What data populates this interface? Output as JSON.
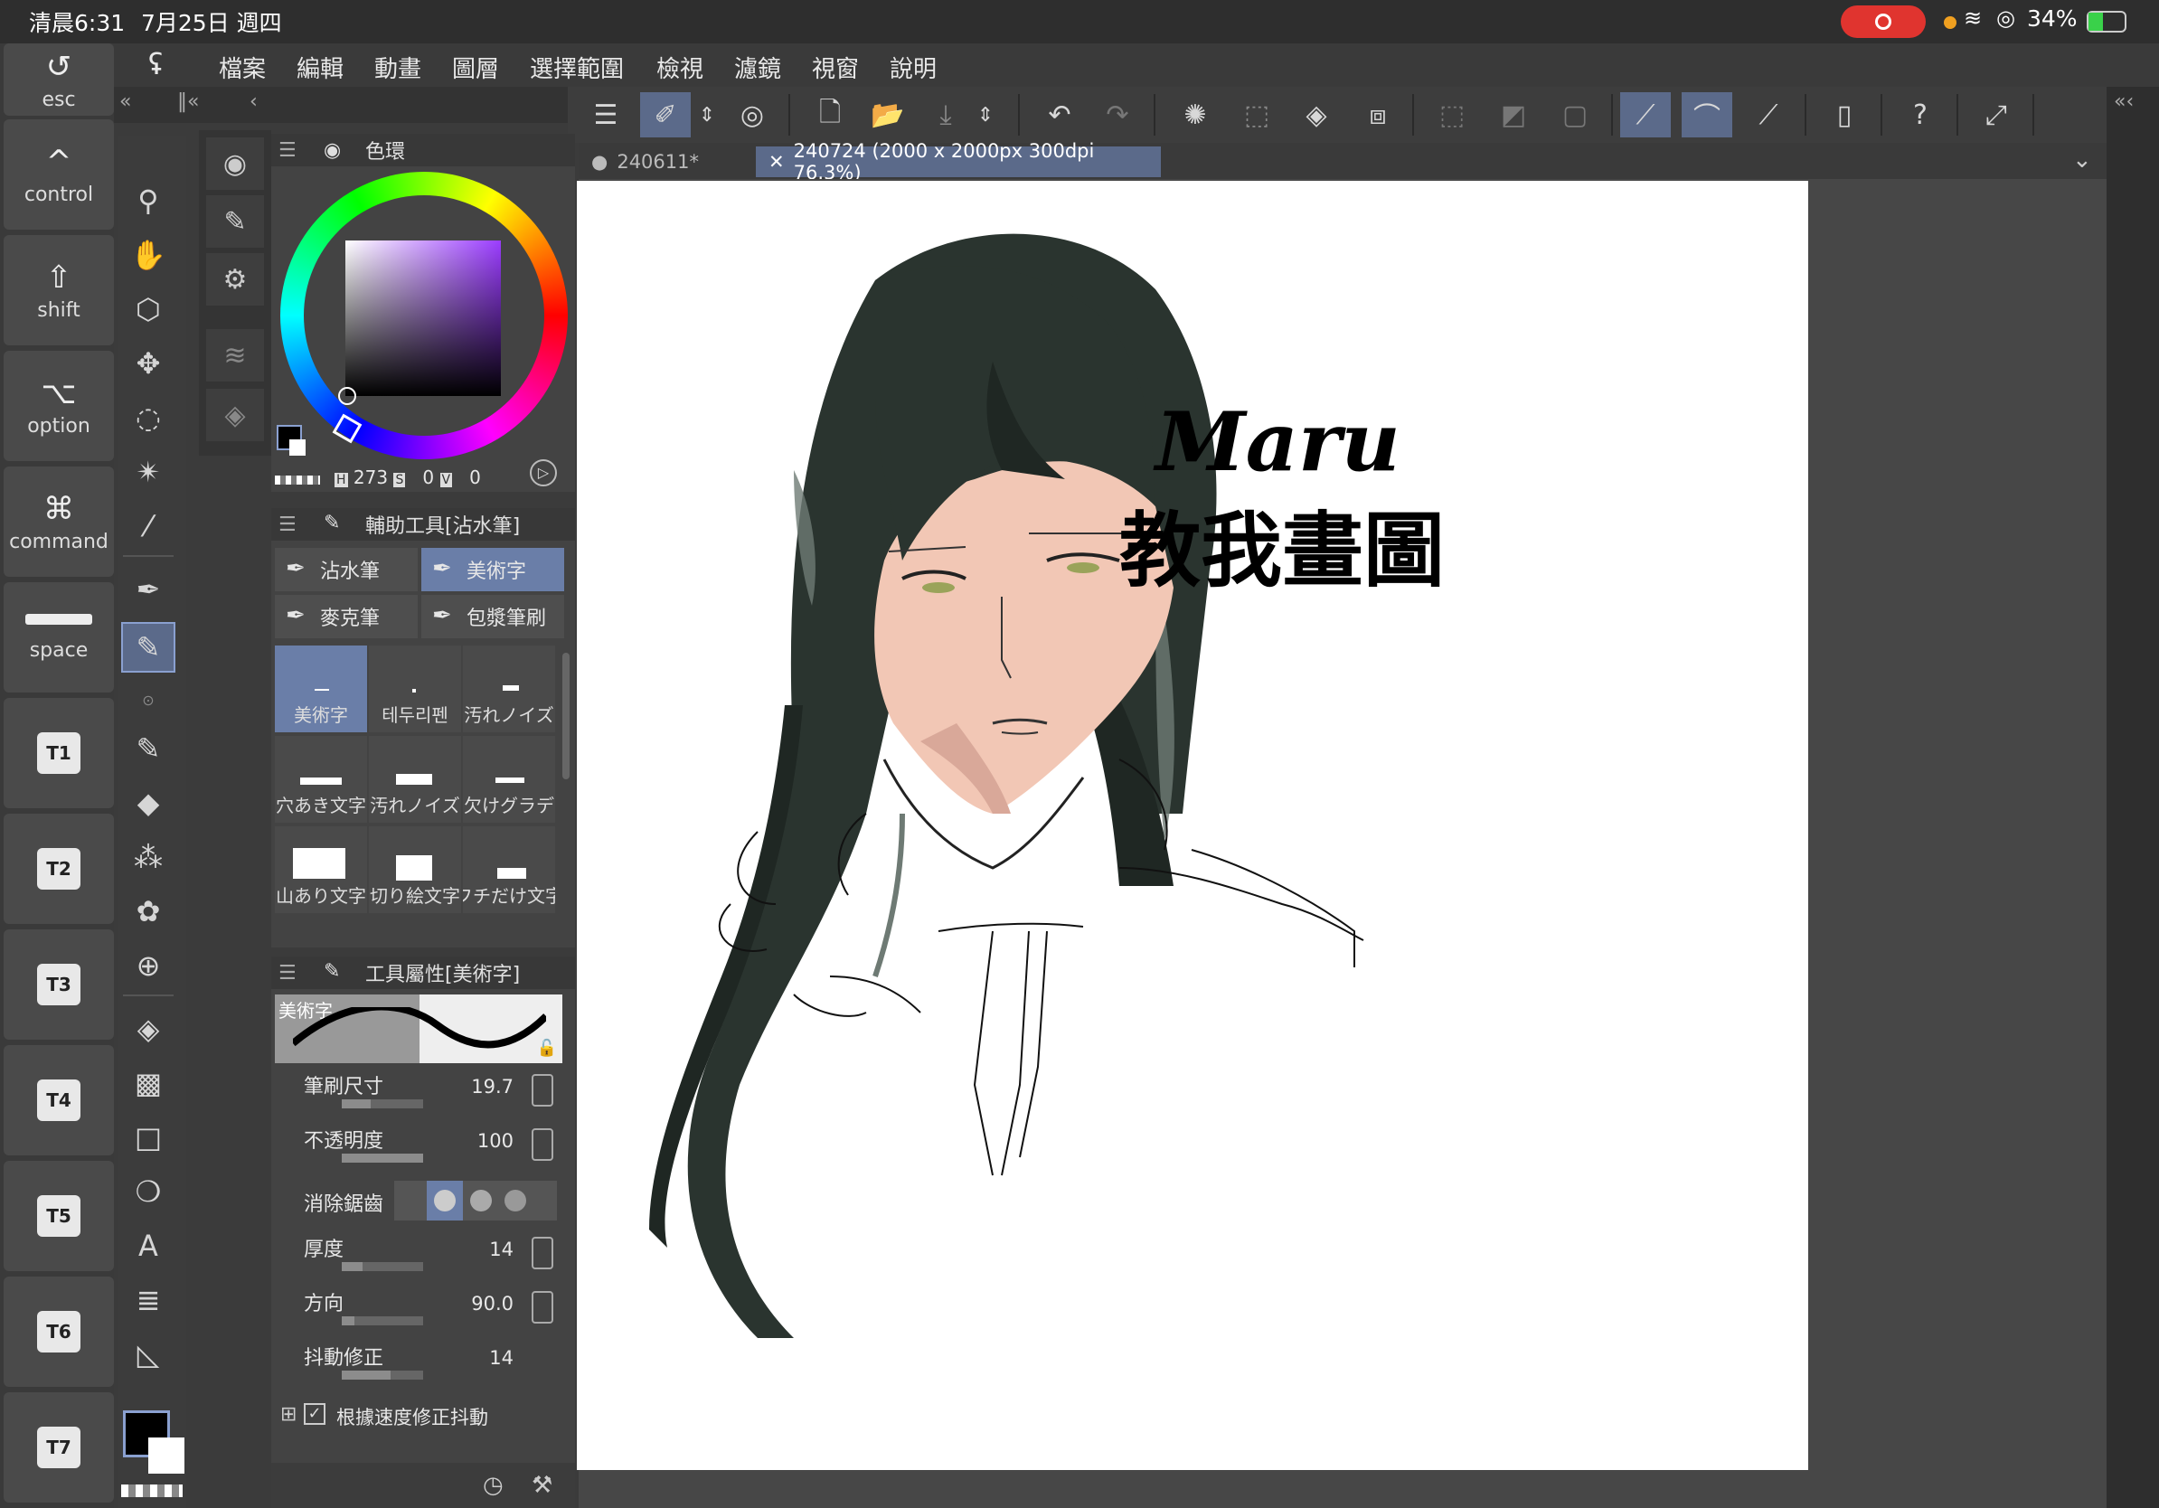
{
  "statusbar": {
    "time": "清晨6:31",
    "date": "7月25日 週四",
    "battery": "34%"
  },
  "keys": [
    {
      "icon": "undo-icon",
      "glyph": "↺",
      "label": "esc"
    },
    {
      "icon": "control-icon",
      "glyph": "^",
      "label": "control"
    },
    {
      "icon": "shift-icon",
      "glyph": "⇧",
      "label": "shift"
    },
    {
      "icon": "option-icon",
      "glyph": "⌥",
      "label": "option"
    },
    {
      "icon": "command-icon",
      "glyph": "⌘",
      "label": "command"
    },
    {
      "icon": "space-icon",
      "glyph": "",
      "label": "space"
    },
    {
      "label": "T1"
    },
    {
      "label": "T2"
    },
    {
      "label": "T3"
    },
    {
      "label": "T4"
    },
    {
      "label": "T5"
    },
    {
      "label": "T6"
    },
    {
      "label": "T7"
    }
  ],
  "menu": [
    "檔案",
    "編輯",
    "動畫",
    "圖層",
    "選擇範圍",
    "檢視",
    "濾鏡",
    "視窗",
    "說明"
  ],
  "colorwheel": {
    "title": "色環",
    "h_label": "H",
    "h": "273",
    "s_label": "S",
    "s": "0",
    "v_label": "V",
    "v": "0",
    "main_color": "#000000",
    "sub_color": "#ffffff"
  },
  "subtool": {
    "title": "輔助工具[沾水筆]",
    "buttons": [
      "沾水筆",
      "美術字",
      "麥克筆",
      "包漿筆刷"
    ],
    "active_button": "美術字",
    "brushes": [
      "美術字",
      "테두리펜",
      "汚れノイズ",
      "穴あき文字",
      "汚れノイズ",
      "欠けグラデ",
      "山あり文字",
      "切り絵文字",
      "フチだけ文字"
    ]
  },
  "toolprops": {
    "title": "工具屬性[美術字]",
    "preview_label": "美術字",
    "props": [
      {
        "label": "筆刷尺寸",
        "value": "19.7",
        "fill": 0.35
      },
      {
        "label": "不透明度",
        "value": "100",
        "fill": 1.0
      },
      {
        "label": "消除鋸齒",
        "value": ""
      },
      {
        "label": "厚度",
        "value": "14",
        "fill": 0.25
      },
      {
        "label": "方向",
        "value": "90.0",
        "fill": 0.15
      },
      {
        "label": "抖動修正",
        "value": "14",
        "fill": 0.6
      }
    ],
    "checkbox": "根據速度修正抖動"
  },
  "tabs": [
    {
      "label": "240611*",
      "active": false
    },
    {
      "label": "240724  (2000 x 2000px 300dpi 76.3%)",
      "active": true
    }
  ],
  "artwork": {
    "signature_line1": "Maru",
    "signature_line2": "教我畫圖"
  }
}
